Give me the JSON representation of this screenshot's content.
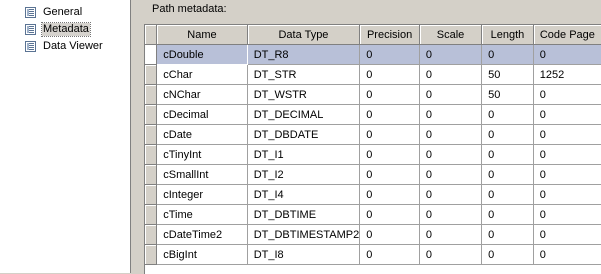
{
  "nav": {
    "items": [
      {
        "label": "General",
        "selected": false
      },
      {
        "label": "Metadata",
        "selected": true
      },
      {
        "label": "Data Viewer",
        "selected": false
      }
    ]
  },
  "content": {
    "title": "Path metadata:"
  },
  "grid": {
    "columns": [
      "Name",
      "Data Type",
      "Precision",
      "Scale",
      "Length",
      "Code Page"
    ],
    "rows": [
      [
        "cDouble",
        "DT_R8",
        "0",
        "0",
        "0",
        "0"
      ],
      [
        "cChar",
        "DT_STR",
        "0",
        "0",
        "50",
        "1252"
      ],
      [
        "cNChar",
        "DT_WSTR",
        "0",
        "0",
        "50",
        "0"
      ],
      [
        "cDecimal",
        "DT_DECIMAL",
        "0",
        "0",
        "0",
        "0"
      ],
      [
        "cDate",
        "DT_DBDATE",
        "0",
        "0",
        "0",
        "0"
      ],
      [
        "cTinyInt",
        "DT_I1",
        "0",
        "0",
        "0",
        "0"
      ],
      [
        "cSmallInt",
        "DT_I2",
        "0",
        "0",
        "0",
        "0"
      ],
      [
        "cInteger",
        "DT_I4",
        "0",
        "0",
        "0",
        "0"
      ],
      [
        "cTime",
        "DT_DBTIME",
        "0",
        "0",
        "0",
        "0"
      ],
      [
        "cDateTime2",
        "DT_DBTIMESTAMP2",
        "0",
        "0",
        "0",
        "0"
      ],
      [
        "cBigInt",
        "DT_I8",
        "0",
        "0",
        "0",
        "0"
      ]
    ],
    "selected_row": 0,
    "selection_color": "#b8c0d8"
  }
}
